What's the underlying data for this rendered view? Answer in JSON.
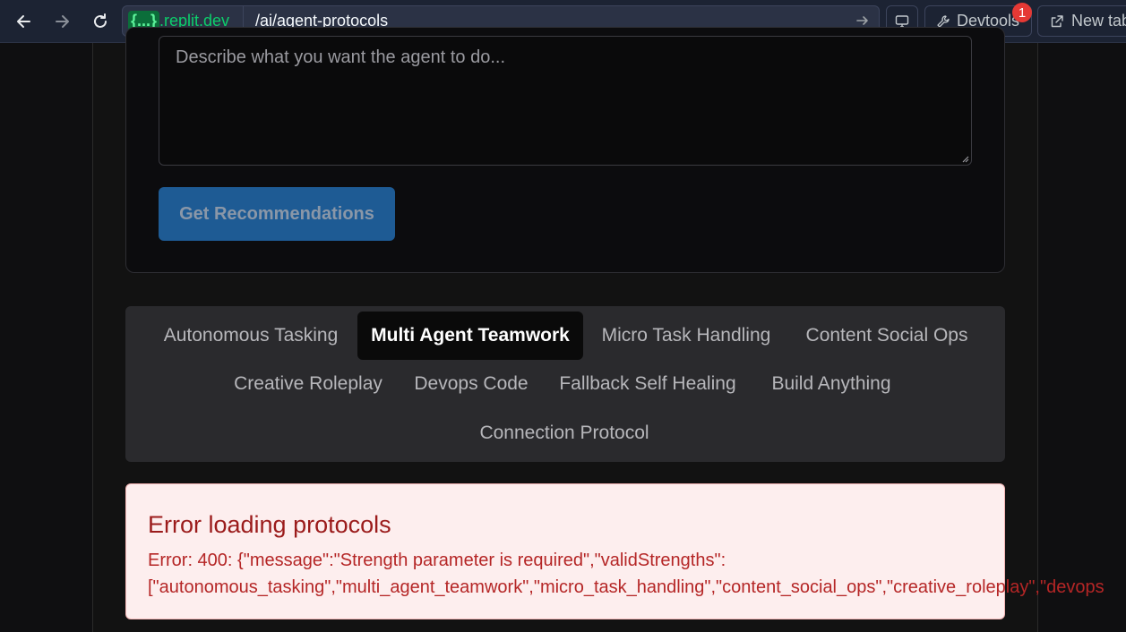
{
  "browser": {
    "url_host_badge": "{...}",
    "url_host": ".replit.dev",
    "url_path": "/ai/agent-protocols",
    "devtools_label": "Devtools",
    "devtools_badge": "1",
    "new_tab_label": "New tab"
  },
  "form": {
    "prompt_placeholder": "Describe what you want the agent to do...",
    "submit_label": "Get Recommendations"
  },
  "tabs": [
    {
      "label": "Autonomous Tasking",
      "active": false
    },
    {
      "label": "Multi Agent Teamwork",
      "active": true
    },
    {
      "label": "Micro Task Handling",
      "active": false
    },
    {
      "label": "Content Social Ops",
      "active": false
    },
    {
      "label": "Creative Roleplay",
      "active": false
    },
    {
      "label": "Devops Code",
      "active": false
    },
    {
      "label": "Fallback Self Healing",
      "active": false
    },
    {
      "label": "Build Anything",
      "active": false
    },
    {
      "label": "Connection Protocol",
      "active": false
    }
  ],
  "error": {
    "title": "Error loading protocols",
    "line1": "Error: 400: {\"message\":\"Strength parameter is required\",\"validStrengths\":",
    "line2": "[\"autonomous_tasking\",\"multi_agent_teamwork\",\"micro_task_handling\",\"content_social_ops\",\"creative_roleplay\",\"devops"
  },
  "colors": {
    "accent": "#1e5b94",
    "error_bg": "#fdeeee",
    "error_text": "#b52626"
  }
}
